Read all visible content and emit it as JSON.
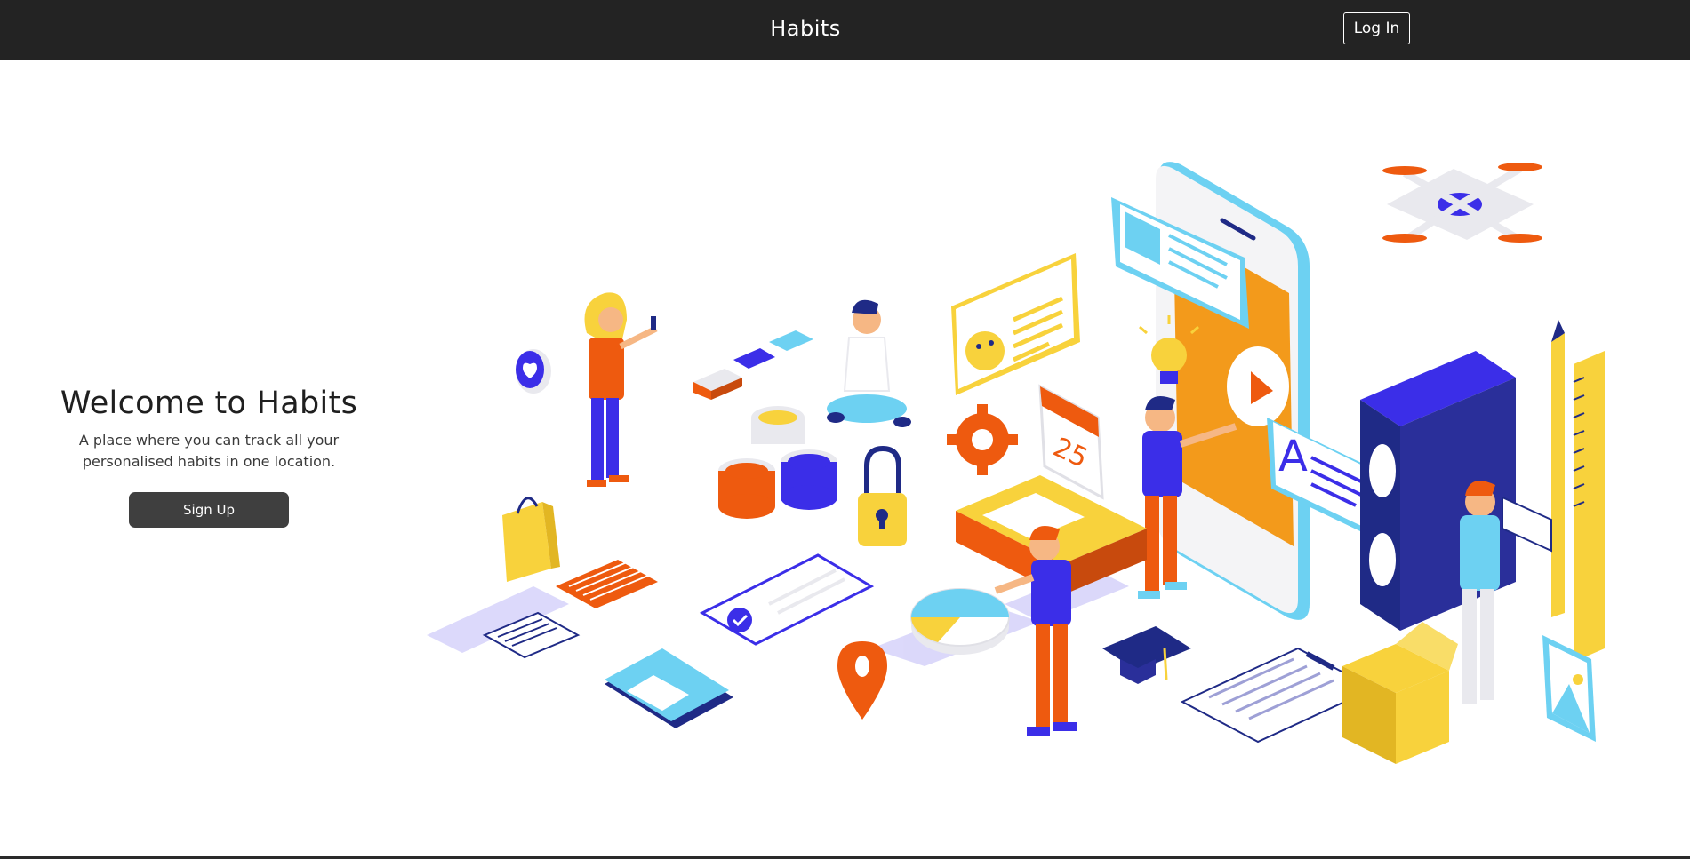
{
  "navbar": {
    "brand": "Habits",
    "login_label": "Log In"
  },
  "hero": {
    "title": "Welcome to Habits",
    "subtitle": "A place where you can track all your personalised habits in one location.",
    "signup_label": "Sign Up"
  },
  "illustration": {
    "calendar_day": "25",
    "palette": {
      "purple": "#3b2ee8",
      "orange": "#ee5a0f",
      "yellow": "#f8d23c",
      "light_blue": "#6dd1f2",
      "navy": "#1f2a86",
      "grey": "#e9e9ee"
    }
  }
}
